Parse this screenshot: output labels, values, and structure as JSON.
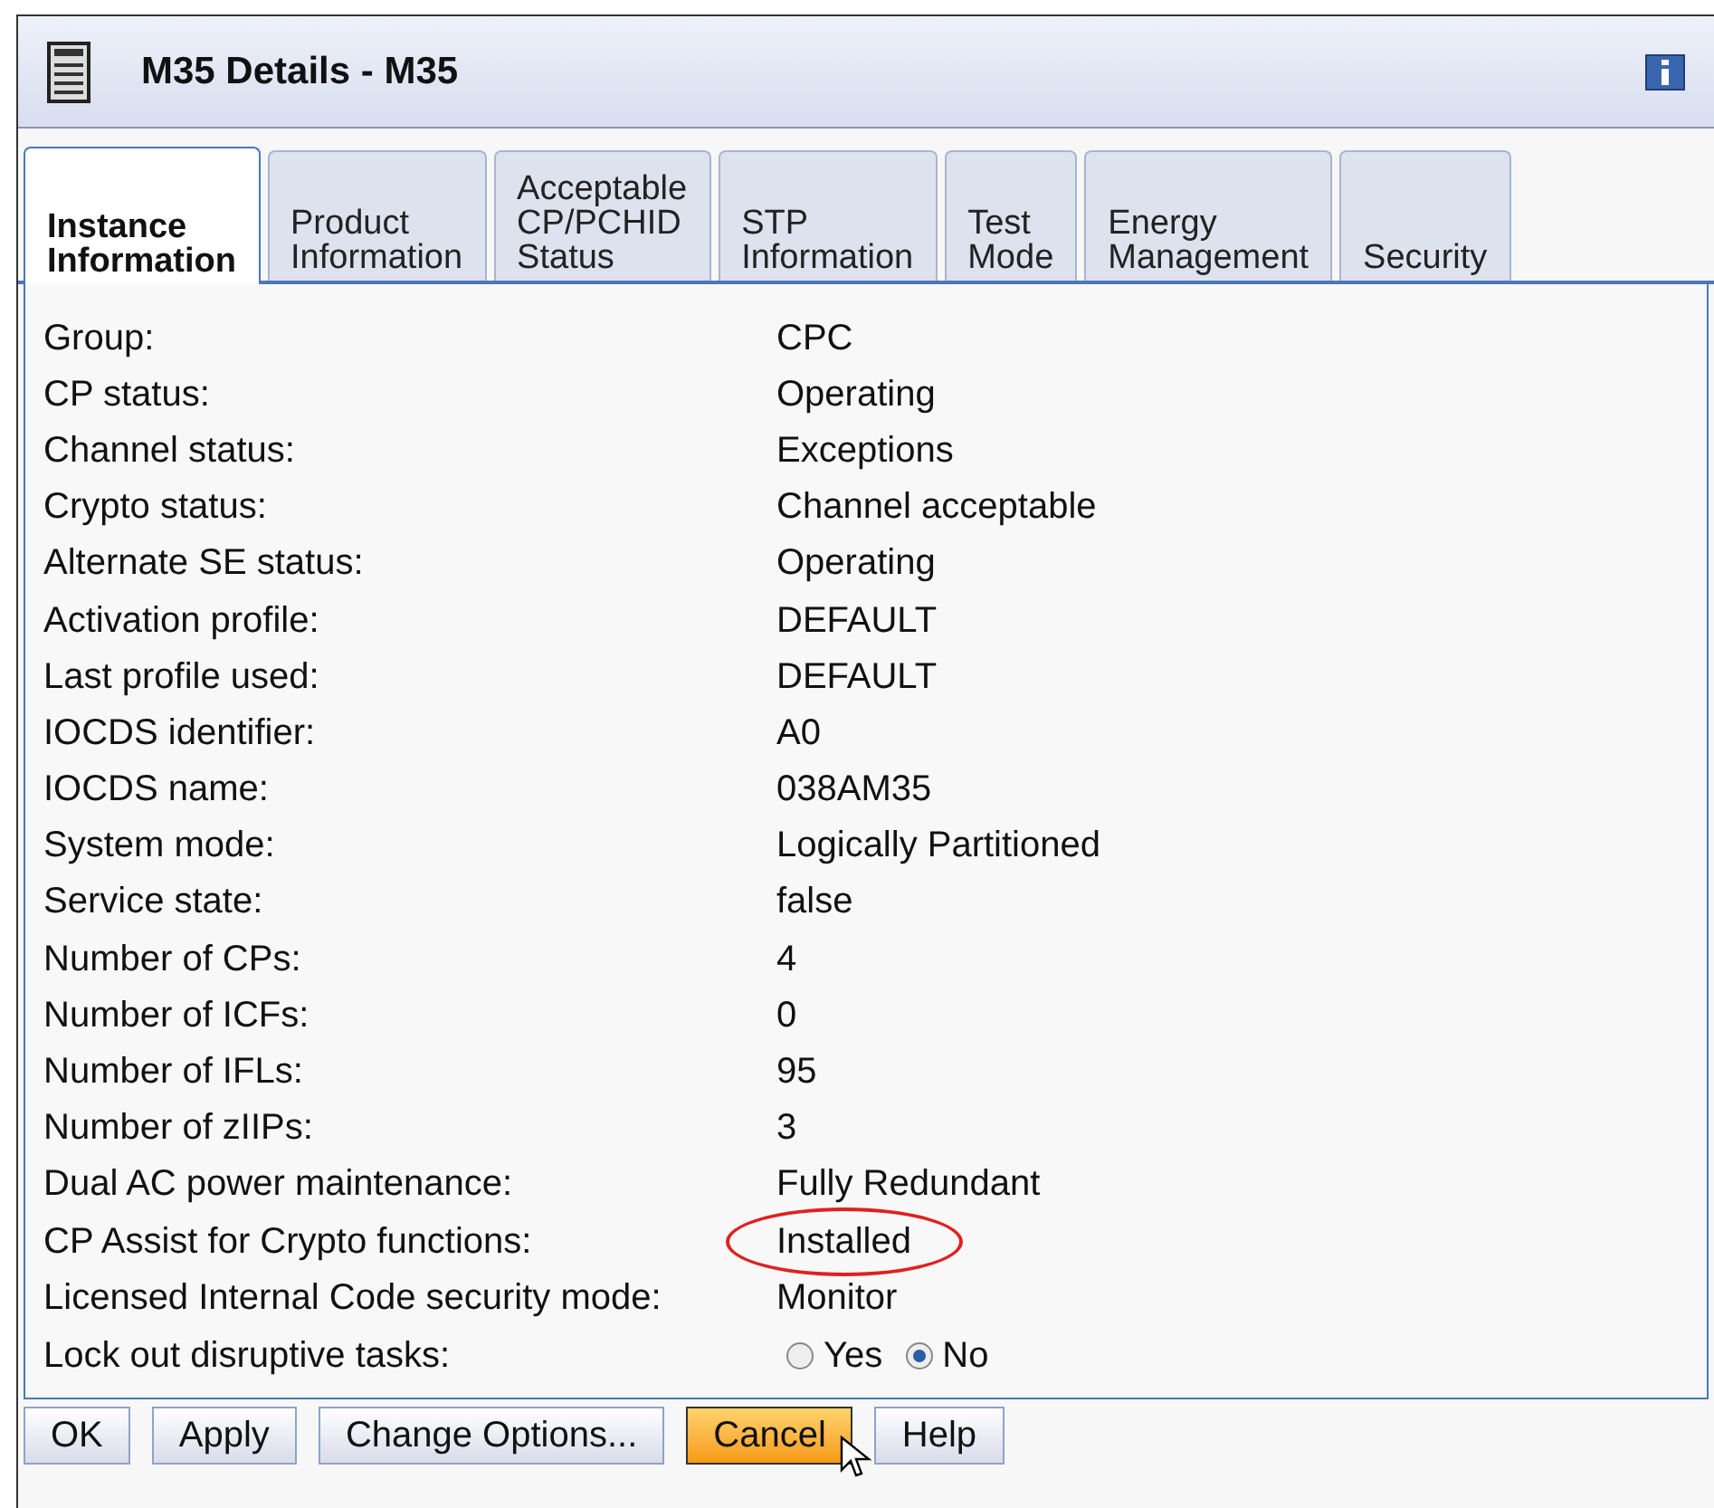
{
  "window": {
    "title": "M35 Details - M35"
  },
  "tabs": [
    {
      "label": "Instance\nInformation",
      "selected": true
    },
    {
      "label": "Product\nInformation",
      "selected": false
    },
    {
      "label": "Acceptable\nCP/PCHID\nStatus",
      "selected": false
    },
    {
      "label": "STP\nInformation",
      "selected": false
    },
    {
      "label": "Test\nMode",
      "selected": false
    },
    {
      "label": "Energy\nManagement",
      "selected": false
    },
    {
      "label": "Security",
      "selected": false
    }
  ],
  "fields": [
    {
      "label": "Group:",
      "value": "CPC",
      "circled": false
    },
    {
      "label": "CP status:",
      "value": "Operating",
      "circled": false
    },
    {
      "label": "Channel status:",
      "value": "Exceptions",
      "circled": false
    },
    {
      "label": "Crypto status:",
      "value": "Channel acceptable",
      "circled": false
    },
    {
      "label": "Alternate SE status:",
      "value": "Operating",
      "circled": false
    },
    {
      "label": "Activation profile:",
      "value": "DEFAULT",
      "circled": false
    },
    {
      "label": "Last profile used:",
      "value": "DEFAULT",
      "circled": false
    },
    {
      "label": "IOCDS identifier:",
      "value": "A0",
      "circled": false
    },
    {
      "label": "IOCDS name:",
      "value": "038AM35",
      "circled": false
    },
    {
      "label": "System mode:",
      "value": "Logically Partitioned",
      "circled": false
    },
    {
      "label": "Service state:",
      "value": "false",
      "circled": false
    },
    {
      "label": "Number of CPs:",
      "value": "4",
      "circled": false
    },
    {
      "label": "Number of ICFs:",
      "value": "0",
      "circled": false
    },
    {
      "label": "Number of IFLs:",
      "value": "95",
      "circled": false
    },
    {
      "label": "Number of zIIPs:",
      "value": "3",
      "circled": false
    },
    {
      "label": "Dual AC power maintenance:",
      "value": "Fully Redundant",
      "circled": false
    },
    {
      "label": "CP Assist for Crypto functions:",
      "value": "Installed",
      "circled": true
    },
    {
      "label": "Licensed Internal Code security mode:",
      "value": "Monitor",
      "circled": false
    }
  ],
  "lockout": {
    "label": "Lock out disruptive tasks:",
    "options": [
      {
        "label": "Yes",
        "selected": false
      },
      {
        "label": "No",
        "selected": true
      }
    ]
  },
  "buttons": [
    {
      "label": "OK",
      "focused": false
    },
    {
      "label": "Apply",
      "focused": false
    },
    {
      "label": "Change Options...",
      "focused": false
    },
    {
      "label": "Cancel",
      "focused": true
    },
    {
      "label": "Help",
      "focused": false
    }
  ]
}
